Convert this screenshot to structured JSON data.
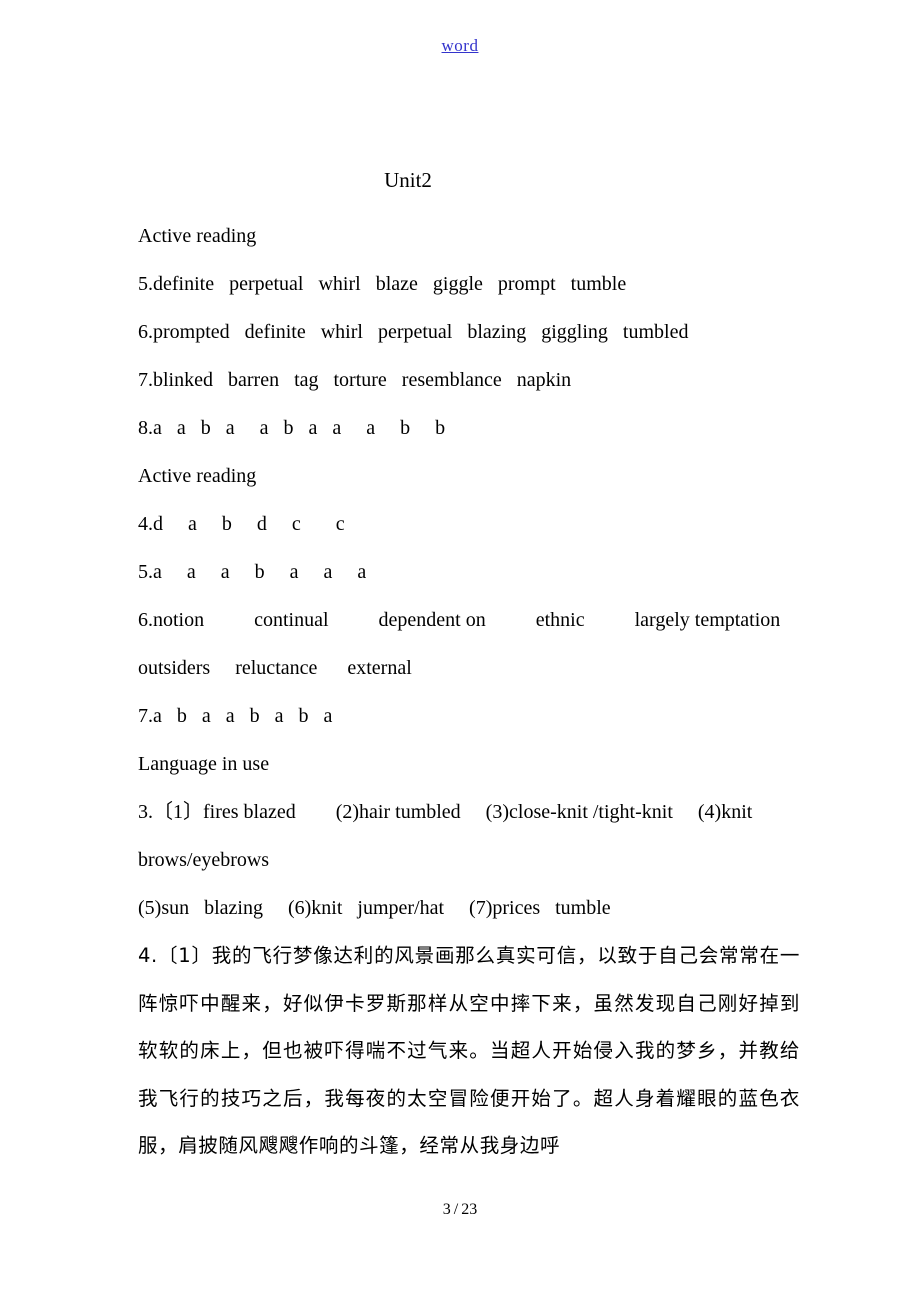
{
  "header": {
    "link_label": "word"
  },
  "document": {
    "title": "Unit2",
    "sections": [
      {
        "id": "active-reading-1",
        "heading": "Active reading"
      },
      {
        "id": "ar1-item5",
        "text": "5.definite   perpetual   whirl   blaze   giggle   prompt   tumble"
      },
      {
        "id": "ar1-item6",
        "text": "6.prompted   definite   whirl   perpetual   blazing   giggling   tumbled"
      },
      {
        "id": "ar1-item7",
        "text": "7.blinked   barren   tag   torture   resemblance   napkin"
      },
      {
        "id": "ar1-item8",
        "text": "8.a   a   b   a     a   b   a   a     a     b     b"
      },
      {
        "id": "active-reading-2",
        "heading": "Active reading"
      },
      {
        "id": "ar2-item4",
        "text": "4.d     a     b     d     c       c"
      },
      {
        "id": "ar2-item5",
        "text": "5.a     a     a     b     a     a     a"
      },
      {
        "id": "ar2-item6",
        "text": "6.notion          continual          dependent on          ethnic          largely temptation      outsiders     reluctance      external"
      },
      {
        "id": "ar2-item7",
        "text": "7.a   b   a   a   b   a   b   a"
      },
      {
        "id": "language-in-use",
        "heading": "Language in use"
      },
      {
        "id": "liu-item3",
        "text": "3.〔1〕fires blazed        (2)hair tumbled     (3)close-knit /tight-knit     (4)knit brows/eyebrows"
      },
      {
        "id": "liu-item3b",
        "text": "(5)sun   blazing     (6)knit   jumper/hat     (7)prices   tumble"
      },
      {
        "id": "liu-item4",
        "text": "4.〔1〕我的飞行梦像达利的风景画那么真实可信，以致于自己会常常在一阵惊吓中醒来，好似伊卡罗斯那样从空中摔下来，虽然发现自己刚好掉到软软的床上，但也被吓得喘不过气来。当超人开始侵入我的梦乡，并教给我飞行的技巧之后，我每夜的太空冒险便开始了。超人身着耀眼的蓝色衣服，肩披随风飕飕作响的斗篷，经常从我身边呼"
      }
    ]
  },
  "footer": {
    "current_page": "3",
    "separator": "/",
    "total_pages": "23"
  },
  "colors": {
    "link": "#3333cc",
    "text": "#000000",
    "page_background": "#ffffff"
  }
}
